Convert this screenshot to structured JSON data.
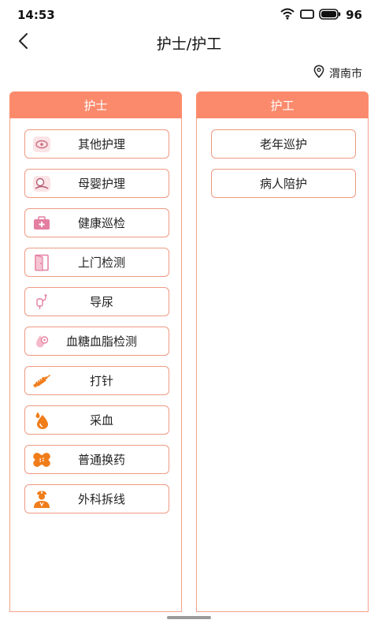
{
  "status_bar": {
    "time": "14:53",
    "battery": "96"
  },
  "nav": {
    "title": "护士/护工"
  },
  "location": {
    "city": "渭南市"
  },
  "nurse": {
    "header": "护士",
    "items": [
      {
        "label": "其他护理",
        "icon": "other-care-icon"
      },
      {
        "label": "母婴护理",
        "icon": "baby-care-icon"
      },
      {
        "label": "健康巡检",
        "icon": "medical-kit-icon"
      },
      {
        "label": "上门检测",
        "icon": "door-icon"
      },
      {
        "label": "导尿",
        "icon": "catheter-icon"
      },
      {
        "label": "血糖血脂检测",
        "icon": "blood-drop-test-icon"
      },
      {
        "label": "打针",
        "icon": "syringe-icon"
      },
      {
        "label": "采血",
        "icon": "blood-drop-icon"
      },
      {
        "label": "普通换药",
        "icon": "bandage-icon"
      },
      {
        "label": "外科拆线",
        "icon": "nurse-person-icon"
      }
    ]
  },
  "caregiver": {
    "header": "护工",
    "items": [
      {
        "label": "老年巡护"
      },
      {
        "label": "病人陪护"
      }
    ]
  },
  "colors": {
    "accent": "#fb8a6c",
    "border": "#ee9a82",
    "icon_orange": "#f07d1a",
    "icon_pink": "#e47fa0"
  }
}
